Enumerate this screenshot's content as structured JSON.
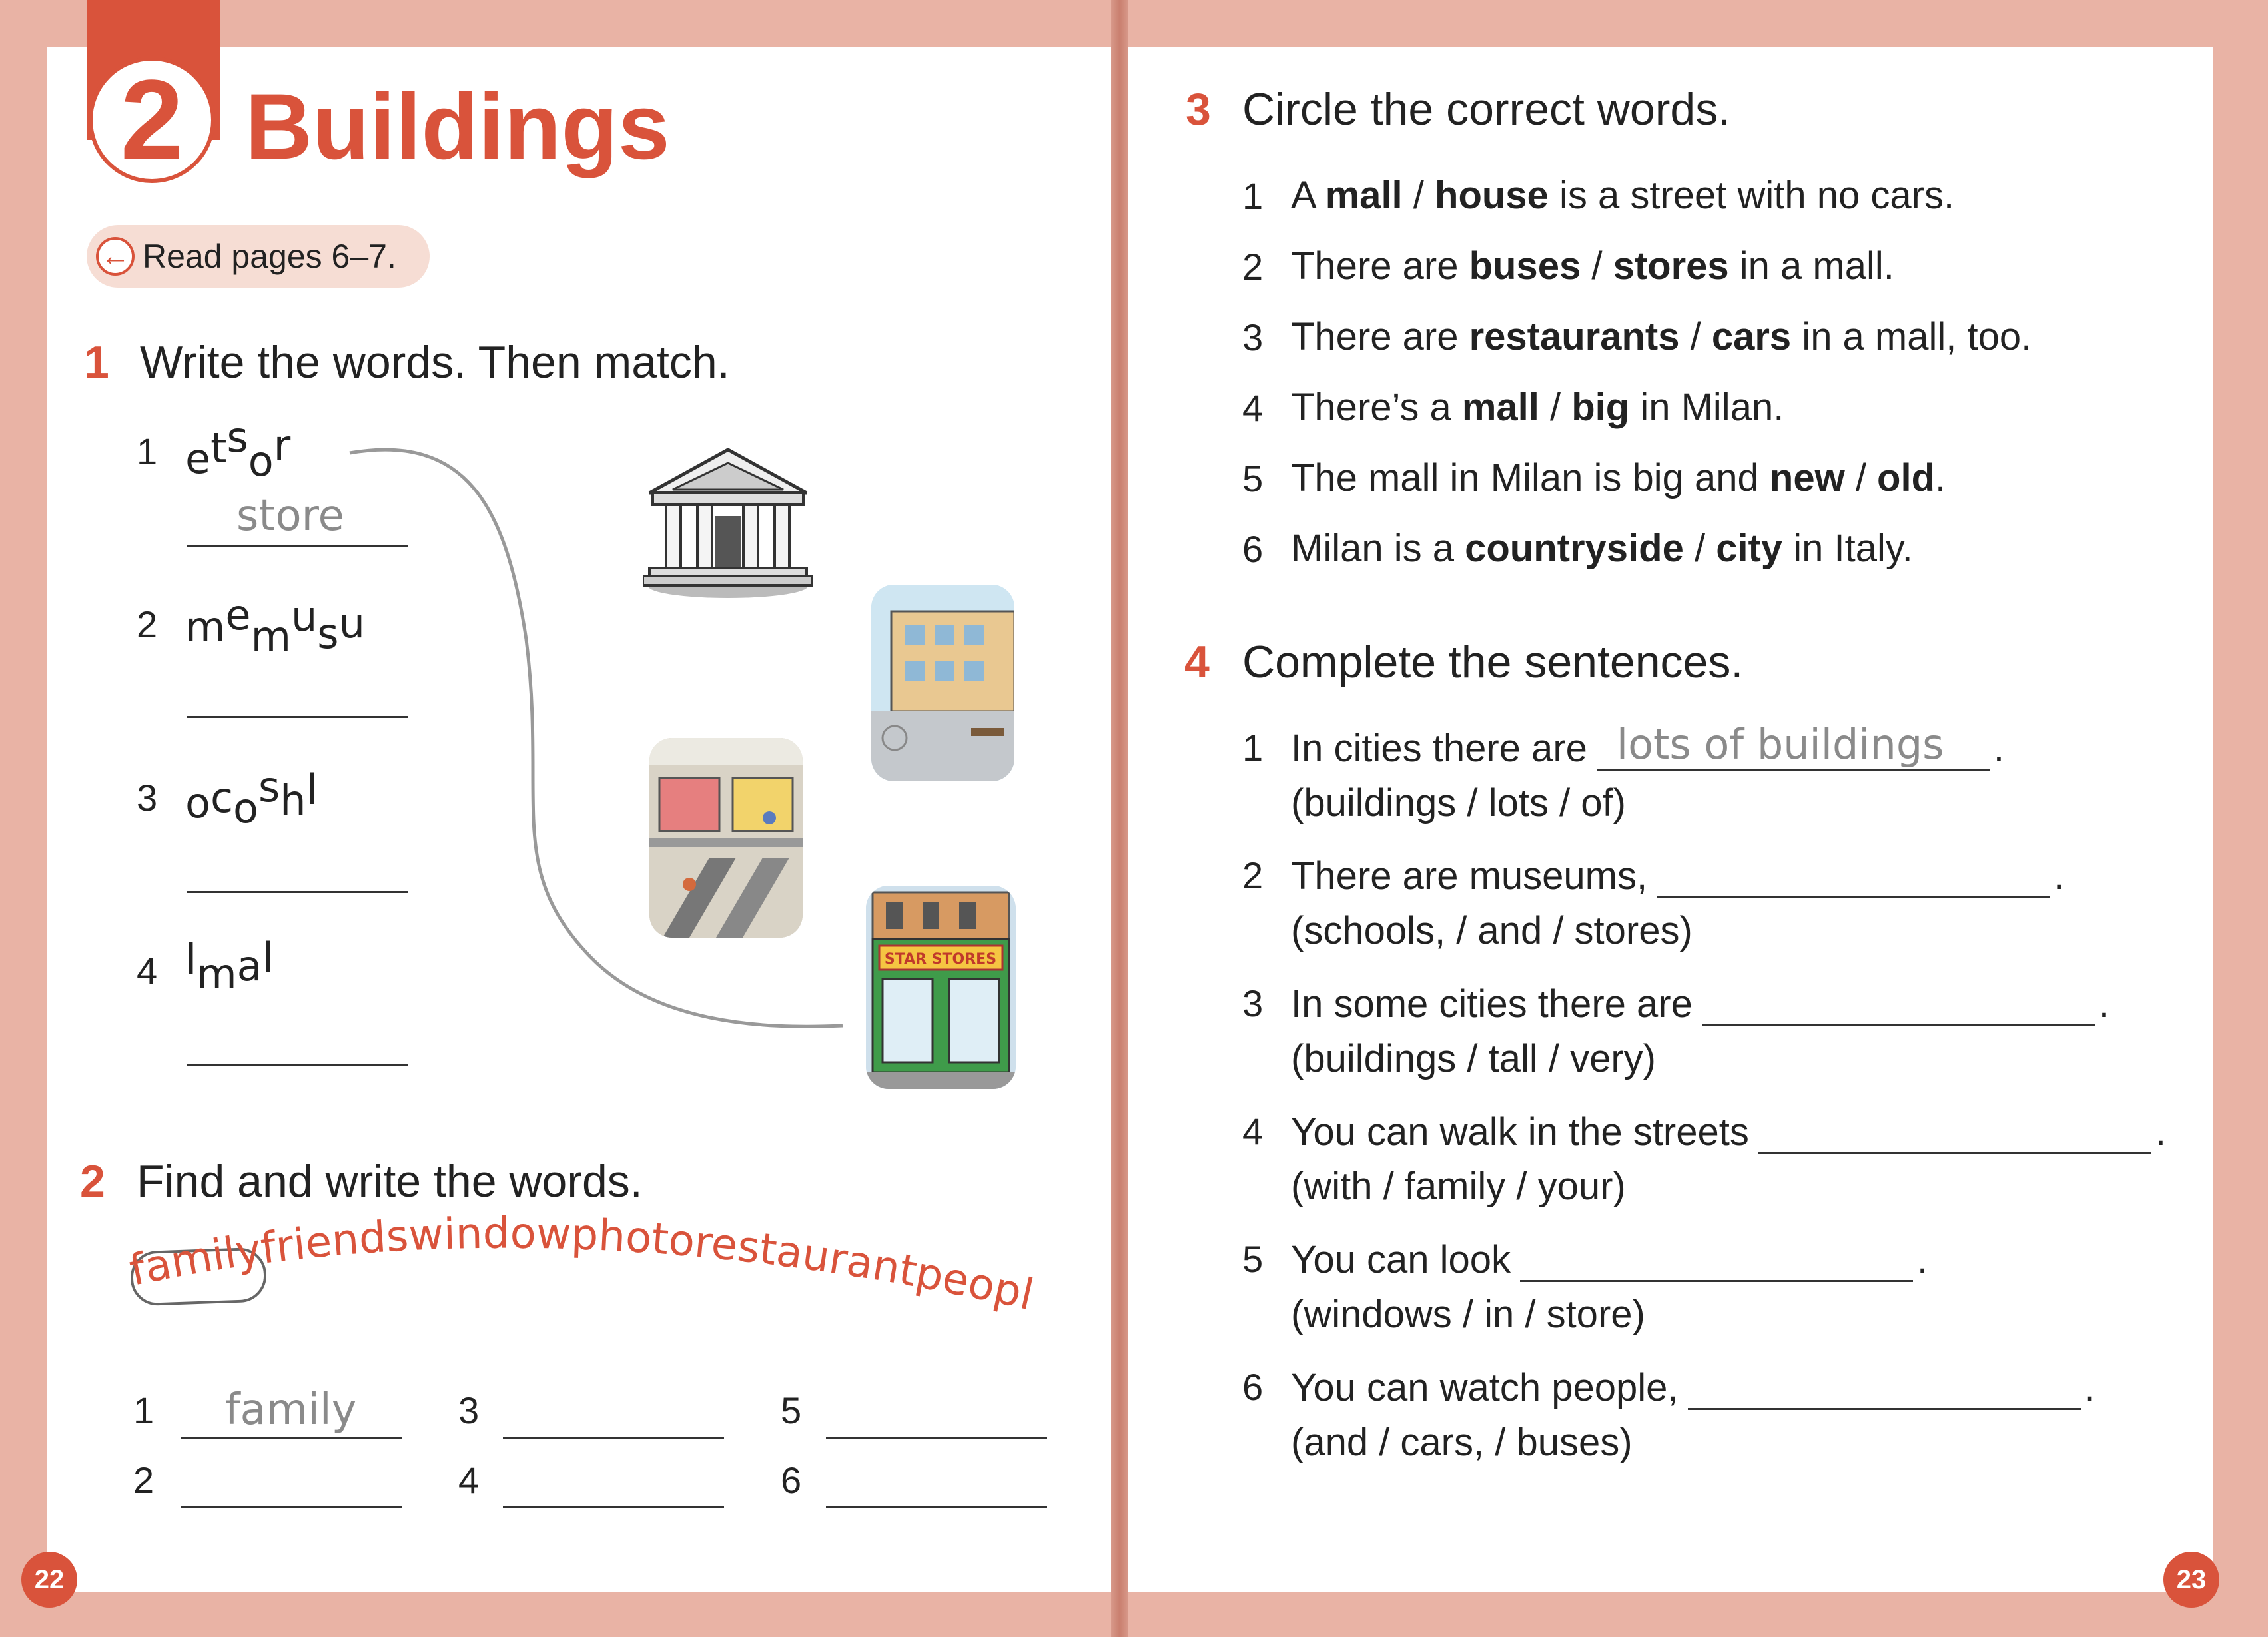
{
  "left_page": {
    "unit_number": "2",
    "unit_title": "Buildings",
    "read_pages": "Read pages 6–7.",
    "page_number": "22",
    "ex1": {
      "number": "1",
      "title": "Write the words. Then match.",
      "items": [
        {
          "n": "1",
          "letters": [
            "e",
            "t",
            "s",
            "o",
            "r"
          ],
          "answer": "store"
        },
        {
          "n": "2",
          "letters": [
            "m",
            "e",
            "m",
            "u",
            "s",
            "u"
          ],
          "answer": ""
        },
        {
          "n": "3",
          "letters": [
            "o",
            "c",
            "o",
            "s",
            "h",
            "l"
          ],
          "answer": ""
        },
        {
          "n": "4",
          "letters": [
            "l",
            "m",
            "a",
            "l"
          ],
          "answer": ""
        }
      ],
      "pictures": [
        "museum-building",
        "school",
        "mall",
        "store"
      ]
    },
    "ex2": {
      "number": "2",
      "title": "Find and write the words.",
      "letter_string": "familyfriendswindowphotorestaurantpeople",
      "answers": [
        {
          "n": "1",
          "value": "family"
        },
        {
          "n": "2",
          "value": ""
        },
        {
          "n": "3",
          "value": ""
        },
        {
          "n": "4",
          "value": ""
        },
        {
          "n": "5",
          "value": ""
        },
        {
          "n": "6",
          "value": ""
        }
      ]
    }
  },
  "right_page": {
    "page_number": "23",
    "ex3": {
      "number": "3",
      "title": "Circle the correct words.",
      "items": [
        {
          "n": "1",
          "pre": "A ",
          "a": "mall",
          "b": "house",
          "post": " is a street with no cars."
        },
        {
          "n": "2",
          "pre": "There are ",
          "a": "buses",
          "b": "stores",
          "post": " in a mall."
        },
        {
          "n": "3",
          "pre": "There are ",
          "a": "restaurants",
          "b": "cars",
          "post": " in a mall, too."
        },
        {
          "n": "4",
          "pre": "There’s a ",
          "a": "mall",
          "b": "big",
          "post": " in Milan."
        },
        {
          "n": "5",
          "pre": "The mall in Milan is big and ",
          "a": "new",
          "b": "old",
          "post": "."
        },
        {
          "n": "6",
          "pre": "Milan is a ",
          "a": "countryside",
          "b": "city",
          "post": " in Italy."
        }
      ]
    },
    "ex4": {
      "number": "4",
      "title": "Complete the sentences.",
      "items": [
        {
          "n": "1",
          "text": "In cities there are",
          "answer": "lots of buildings",
          "hint": "(buildings / lots / of)"
        },
        {
          "n": "2",
          "text": "There are museums,",
          "answer": "",
          "hint": "(schools, / and / stores)"
        },
        {
          "n": "3",
          "text": "In some cities there are",
          "answer": "",
          "hint": "(buildings / tall / very)"
        },
        {
          "n": "4",
          "text": "You can walk in the streets",
          "answer": "",
          "hint": "(with / family / your)"
        },
        {
          "n": "5",
          "text": "You can look",
          "answer": "",
          "hint": "(windows / in / store)"
        },
        {
          "n": "6",
          "text": "You can watch people,",
          "answer": "",
          "hint": "(and / cars, / buses)"
        }
      ]
    }
  },
  "colors": {
    "accent": "#d9533b",
    "page_edge": "#e9b3a5",
    "handwriting": "#8a8a8a"
  }
}
